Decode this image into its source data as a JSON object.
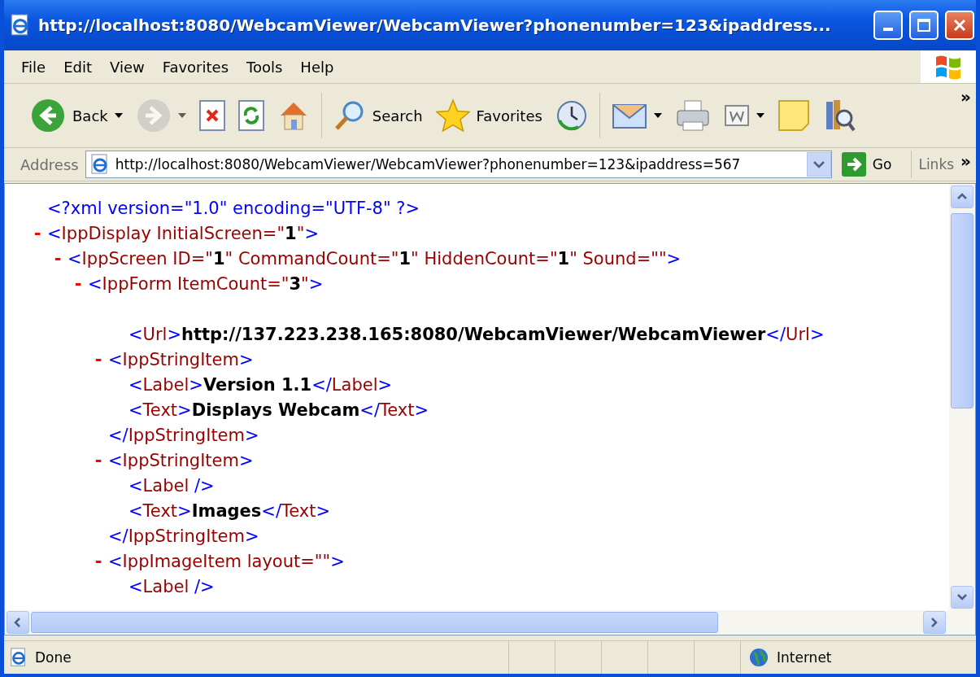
{
  "window": {
    "title": "http://localhost:8080/WebcamViewer/WebcamViewer?phonenumber=123&ipaddress..."
  },
  "menu": [
    "File",
    "Edit",
    "View",
    "Favorites",
    "Tools",
    "Help"
  ],
  "toolbar": {
    "buttons": [
      {
        "kind": "back",
        "label": "Back",
        "dropdown": true,
        "disabled": false
      },
      {
        "kind": "forward",
        "dropdown": true,
        "disabled": true
      },
      {
        "kind": "stop",
        "dropdown": false,
        "disabled": false
      },
      {
        "kind": "refresh",
        "dropdown": false,
        "disabled": false
      },
      {
        "kind": "home",
        "dropdown": false,
        "disabled": false
      },
      {
        "kind": "search",
        "label": "Search",
        "dropdown": false,
        "disabled": false
      },
      {
        "kind": "favorites",
        "label": "Favorites",
        "dropdown": false,
        "disabled": false
      },
      {
        "kind": "history",
        "dropdown": false,
        "disabled": false
      },
      {
        "kind": "mail",
        "dropdown": true,
        "disabled": false
      },
      {
        "kind": "print",
        "dropdown": false,
        "disabled": false
      },
      {
        "kind": "edit",
        "dropdown": true,
        "disabled": false
      },
      {
        "kind": "note",
        "dropdown": false,
        "disabled": false
      },
      {
        "kind": "research",
        "dropdown": false,
        "disabled": false
      }
    ],
    "overflow": "»"
  },
  "address": {
    "label": "Address",
    "url": "http://localhost:8080/WebcamViewer/WebcamViewer?phonenumber=123&ipaddress=567",
    "go": "Go",
    "links": "Links",
    "links_overflow": "»"
  },
  "document": [
    {
      "tokens": [
        {
          "kind": "punct",
          "text": "<?xml version=\"1.0\" encoding=\"UTF-8\" ?>"
        }
      ]
    },
    {
      "toggle": "-",
      "tokens": [
        {
          "kind": "punct",
          "text": "<"
        },
        {
          "kind": "name",
          "text": "IppDisplay InitialScreen=\""
        },
        {
          "kind": "value",
          "text": "1"
        },
        {
          "kind": "name",
          "text": "\""
        },
        {
          "kind": "punct",
          "text": ">"
        }
      ],
      "children": [
        {
          "toggle": "-",
          "tokens": [
            {
              "kind": "punct",
              "text": "<"
            },
            {
              "kind": "name",
              "text": "IppScreen ID=\""
            },
            {
              "kind": "value",
              "text": "1"
            },
            {
              "kind": "name",
              "text": "\" CommandCount=\""
            },
            {
              "kind": "value",
              "text": "1"
            },
            {
              "kind": "name",
              "text": "\" HiddenCount=\""
            },
            {
              "kind": "value",
              "text": "1"
            },
            {
              "kind": "name",
              "text": "\" Sound=\"\""
            },
            {
              "kind": "punct",
              "text": ">"
            }
          ],
          "children": [
            {
              "toggle": "-",
              "tokens": [
                {
                  "kind": "punct",
                  "text": "<"
                },
                {
                  "kind": "name",
                  "text": "IppForm ItemCount=\""
                },
                {
                  "kind": "value",
                  "text": "3"
                },
                {
                  "kind": "name",
                  "text": "\""
                },
                {
                  "kind": "punct",
                  "text": ">"
                }
              ],
              "children": [
                {
                  "children": [
                    {
                      "tokens": [
                        {
                          "kind": "punct",
                          "text": "<"
                        },
                        {
                          "kind": "name",
                          "text": "Url"
                        },
                        {
                          "kind": "punct",
                          "text": ">"
                        },
                        {
                          "kind": "text",
                          "text": "http://137.223.238.165:8080/WebcamViewer/WebcamViewer"
                        },
                        {
                          "kind": "punct",
                          "text": "</"
                        },
                        {
                          "kind": "name",
                          "text": "Url"
                        },
                        {
                          "kind": "punct",
                          "text": ">"
                        }
                      ]
                    }
                  ]
                },
                {
                  "toggle": "-",
                  "tokens": [
                    {
                      "kind": "punct",
                      "text": "<"
                    },
                    {
                      "kind": "name",
                      "text": "IppStringItem"
                    },
                    {
                      "kind": "punct",
                      "text": ">"
                    }
                  ],
                  "children": [
                    {
                      "tokens": [
                        {
                          "kind": "punct",
                          "text": "<"
                        },
                        {
                          "kind": "name",
                          "text": "Label"
                        },
                        {
                          "kind": "punct",
                          "text": ">"
                        },
                        {
                          "kind": "text",
                          "text": "Version 1.1"
                        },
                        {
                          "kind": "punct",
                          "text": "</"
                        },
                        {
                          "kind": "name",
                          "text": "Label"
                        },
                        {
                          "kind": "punct",
                          "text": ">"
                        }
                      ]
                    },
                    {
                      "tokens": [
                        {
                          "kind": "punct",
                          "text": "<"
                        },
                        {
                          "kind": "name",
                          "text": "Text"
                        },
                        {
                          "kind": "punct",
                          "text": ">"
                        },
                        {
                          "kind": "text",
                          "text": "Displays Webcam"
                        },
                        {
                          "kind": "punct",
                          "text": "</"
                        },
                        {
                          "kind": "name",
                          "text": "Text"
                        },
                        {
                          "kind": "punct",
                          "text": ">"
                        }
                      ]
                    }
                  ],
                  "close": [
                    {
                      "kind": "punct",
                      "text": "</"
                    },
                    {
                      "kind": "name",
                      "text": "IppStringItem"
                    },
                    {
                      "kind": "punct",
                      "text": ">"
                    }
                  ]
                },
                {
                  "toggle": "-",
                  "tokens": [
                    {
                      "kind": "punct",
                      "text": "<"
                    },
                    {
                      "kind": "name",
                      "text": "IppStringItem"
                    },
                    {
                      "kind": "punct",
                      "text": ">"
                    }
                  ],
                  "children": [
                    {
                      "tokens": [
                        {
                          "kind": "punct",
                          "text": "<"
                        },
                        {
                          "kind": "name",
                          "text": "Label"
                        },
                        {
                          "kind": "punct",
                          "text": " />"
                        }
                      ]
                    },
                    {
                      "tokens": [
                        {
                          "kind": "punct",
                          "text": "<"
                        },
                        {
                          "kind": "name",
                          "text": "Text"
                        },
                        {
                          "kind": "punct",
                          "text": ">"
                        },
                        {
                          "kind": "text",
                          "text": "Images"
                        },
                        {
                          "kind": "punct",
                          "text": "</"
                        },
                        {
                          "kind": "name",
                          "text": "Text"
                        },
                        {
                          "kind": "punct",
                          "text": ">"
                        }
                      ]
                    }
                  ],
                  "close": [
                    {
                      "kind": "punct",
                      "text": "</"
                    },
                    {
                      "kind": "name",
                      "text": "IppStringItem"
                    },
                    {
                      "kind": "punct",
                      "text": ">"
                    }
                  ]
                },
                {
                  "toggle": "-",
                  "tokens": [
                    {
                      "kind": "punct",
                      "text": "<"
                    },
                    {
                      "kind": "name",
                      "text": "IppImageItem layout=\"\""
                    },
                    {
                      "kind": "punct",
                      "text": ">"
                    }
                  ],
                  "children": [
                    {
                      "tokens": [
                        {
                          "kind": "punct",
                          "text": "<"
                        },
                        {
                          "kind": "name",
                          "text": "Label"
                        },
                        {
                          "kind": "punct",
                          "text": " />"
                        }
                      ]
                    }
                  ]
                }
              ]
            }
          ]
        }
      ]
    }
  ],
  "status_bar": {
    "text": "Done",
    "zone": "Internet"
  }
}
